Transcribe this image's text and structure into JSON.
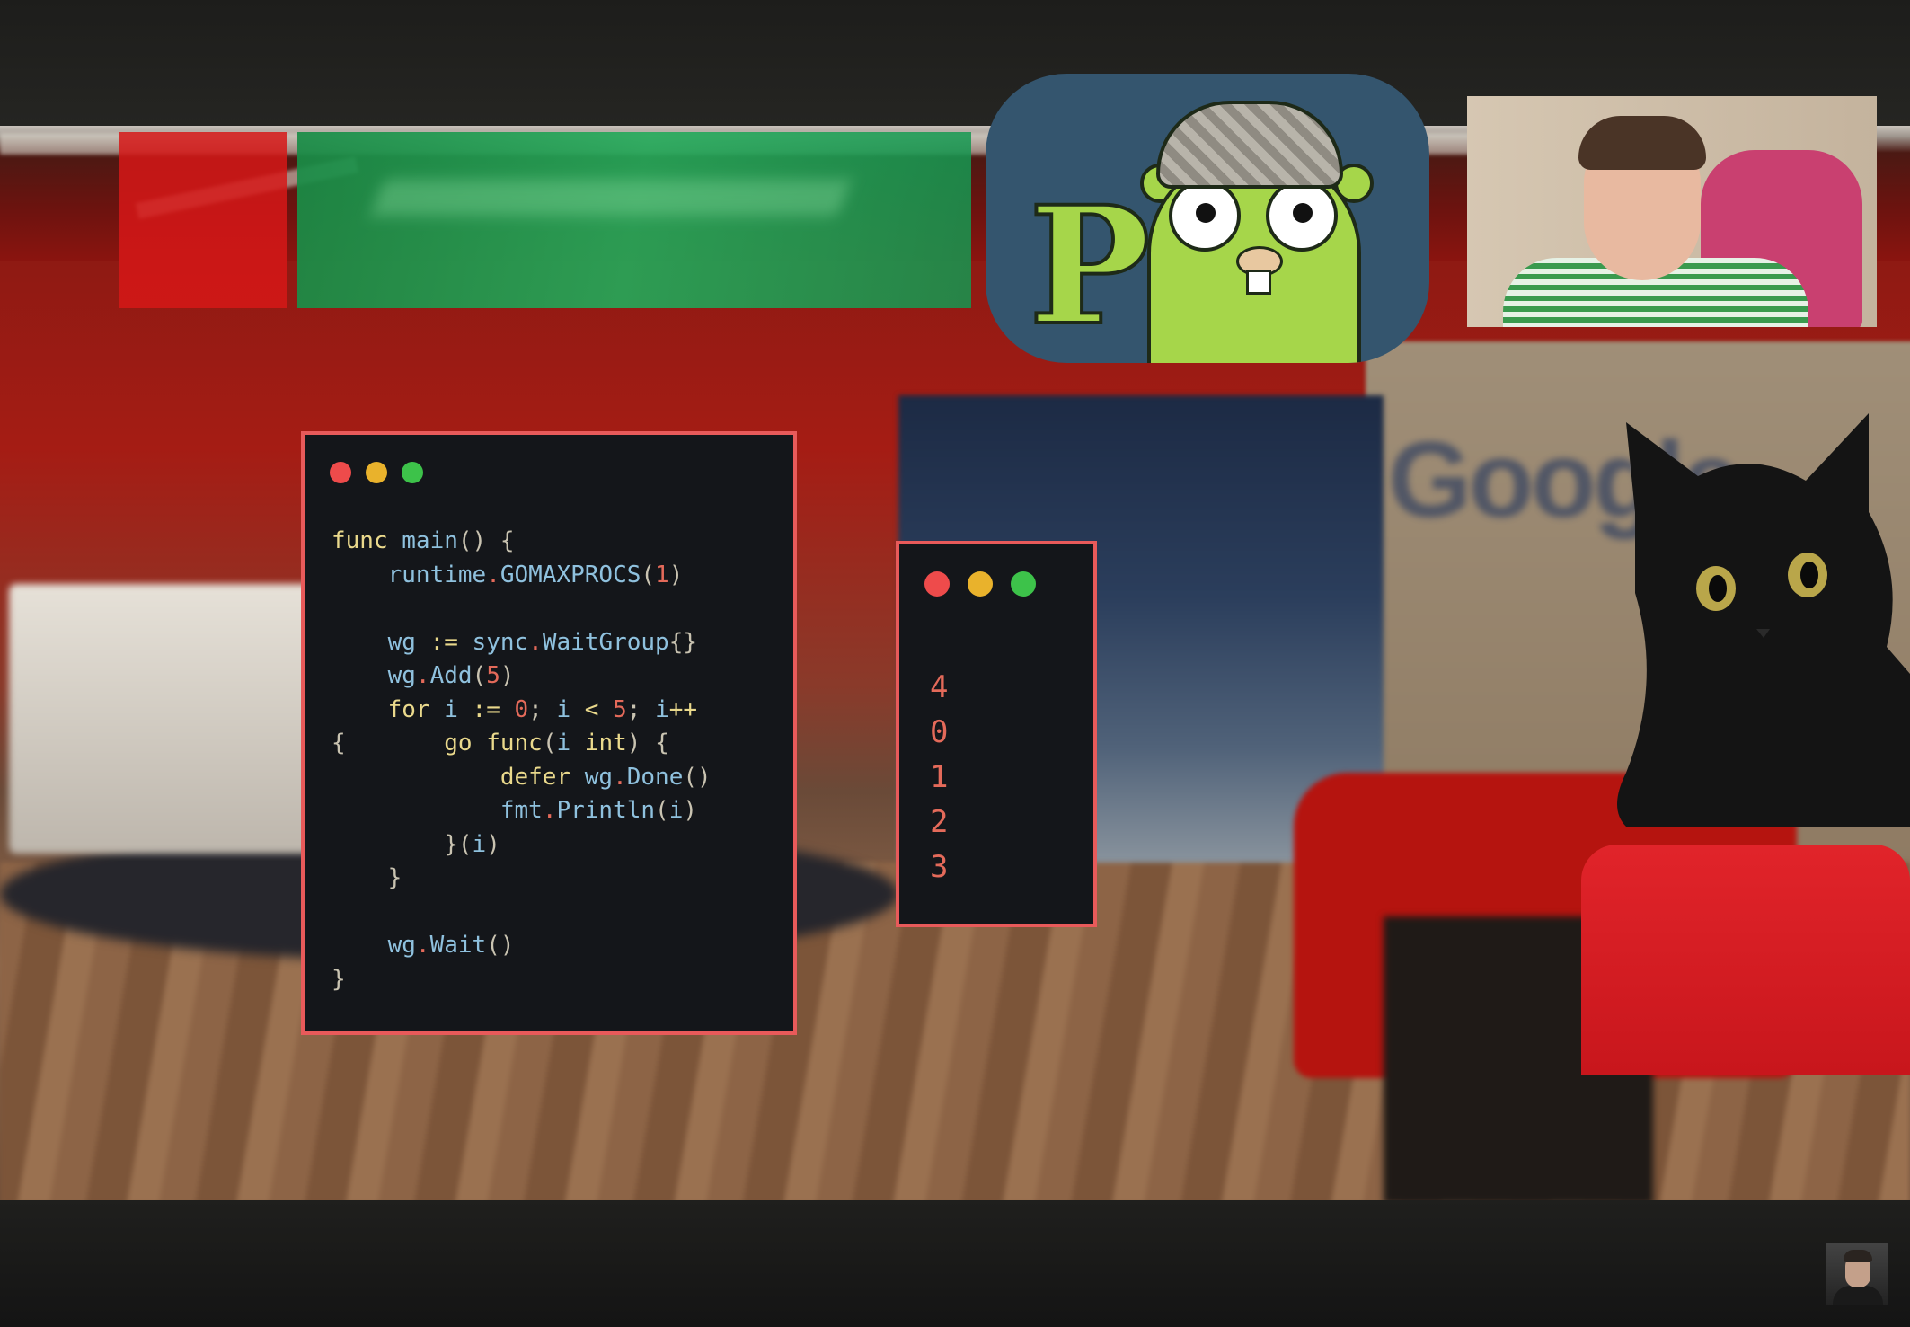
{
  "code_window": {
    "lines": [
      [
        {
          "t": "func ",
          "c": "kw"
        },
        {
          "t": "main",
          "c": "id"
        },
        {
          "t": "() {",
          "c": "op"
        }
      ],
      [
        {
          "t": "    runtime",
          "c": "id"
        },
        {
          "t": ".",
          "c": "num"
        },
        {
          "t": "GOMAXPROCS",
          "c": "id"
        },
        {
          "t": "(",
          "c": "op"
        },
        {
          "t": "1",
          "c": "num"
        },
        {
          "t": ")",
          "c": "op"
        }
      ],
      [],
      [
        {
          "t": "    wg ",
          "c": "id"
        },
        {
          "t": ":= ",
          "c": "kw"
        },
        {
          "t": "sync",
          "c": "id"
        },
        {
          "t": ".",
          "c": "num"
        },
        {
          "t": "WaitGroup",
          "c": "id"
        },
        {
          "t": "{}",
          "c": "op"
        }
      ],
      [
        {
          "t": "    wg",
          "c": "id"
        },
        {
          "t": ".",
          "c": "num"
        },
        {
          "t": "Add",
          "c": "id"
        },
        {
          "t": "(",
          "c": "op"
        },
        {
          "t": "5",
          "c": "num"
        },
        {
          "t": ")",
          "c": "op"
        }
      ],
      [
        {
          "t": "    for ",
          "c": "kw"
        },
        {
          "t": "i ",
          "c": "id"
        },
        {
          "t": ":= ",
          "c": "kw"
        },
        {
          "t": "0",
          "c": "num"
        },
        {
          "t": "; ",
          "c": "op"
        },
        {
          "t": "i ",
          "c": "id"
        },
        {
          "t": "< ",
          "c": "kw"
        },
        {
          "t": "5",
          "c": "num"
        },
        {
          "t": "; ",
          "c": "op"
        },
        {
          "t": "i",
          "c": "id"
        },
        {
          "t": "++",
          "c": "kw"
        }
      ],
      [
        {
          "t": "{       ",
          "c": "op"
        },
        {
          "t": "go ",
          "c": "kw"
        },
        {
          "t": "func",
          "c": "kw"
        },
        {
          "t": "(",
          "c": "op"
        },
        {
          "t": "i ",
          "c": "id"
        },
        {
          "t": "int",
          "c": "kw"
        },
        {
          "t": ") {",
          "c": "op"
        }
      ],
      [
        {
          "t": "            defer ",
          "c": "kw"
        },
        {
          "t": "wg",
          "c": "id"
        },
        {
          "t": ".",
          "c": "num"
        },
        {
          "t": "Done",
          "c": "id"
        },
        {
          "t": "()",
          "c": "op"
        }
      ],
      [
        {
          "t": "            fmt",
          "c": "id"
        },
        {
          "t": ".",
          "c": "num"
        },
        {
          "t": "Println",
          "c": "id"
        },
        {
          "t": "(",
          "c": "op"
        },
        {
          "t": "i",
          "c": "id"
        },
        {
          "t": ")",
          "c": "op"
        }
      ],
      [
        {
          "t": "        }(",
          "c": "op"
        },
        {
          "t": "i",
          "c": "id"
        },
        {
          "t": ")",
          "c": "op"
        }
      ],
      [
        {
          "t": "    }",
          "c": "op"
        }
      ],
      [],
      [
        {
          "t": "    wg",
          "c": "id"
        },
        {
          "t": ".",
          "c": "num"
        },
        {
          "t": "Wait",
          "c": "id"
        },
        {
          "t": "()",
          "c": "op"
        }
      ],
      [
        {
          "t": "}",
          "c": "op"
        }
      ]
    ]
  },
  "output_window": {
    "lines": [
      "4",
      "0",
      "1",
      "2",
      "3"
    ]
  },
  "colors": {
    "window_border": "#e85a5a",
    "keyword": "#ead98c",
    "identifier": "#8fc1de",
    "number": "#e46a5a",
    "banner_red": "#d61818",
    "banner_green": "#1c8c46"
  },
  "icons": {
    "mac_dots": [
      "close-dot",
      "minimize-dot",
      "maximize-dot"
    ],
    "logo": "go-gopher-detective-logo",
    "channel": "channel-avatar"
  }
}
